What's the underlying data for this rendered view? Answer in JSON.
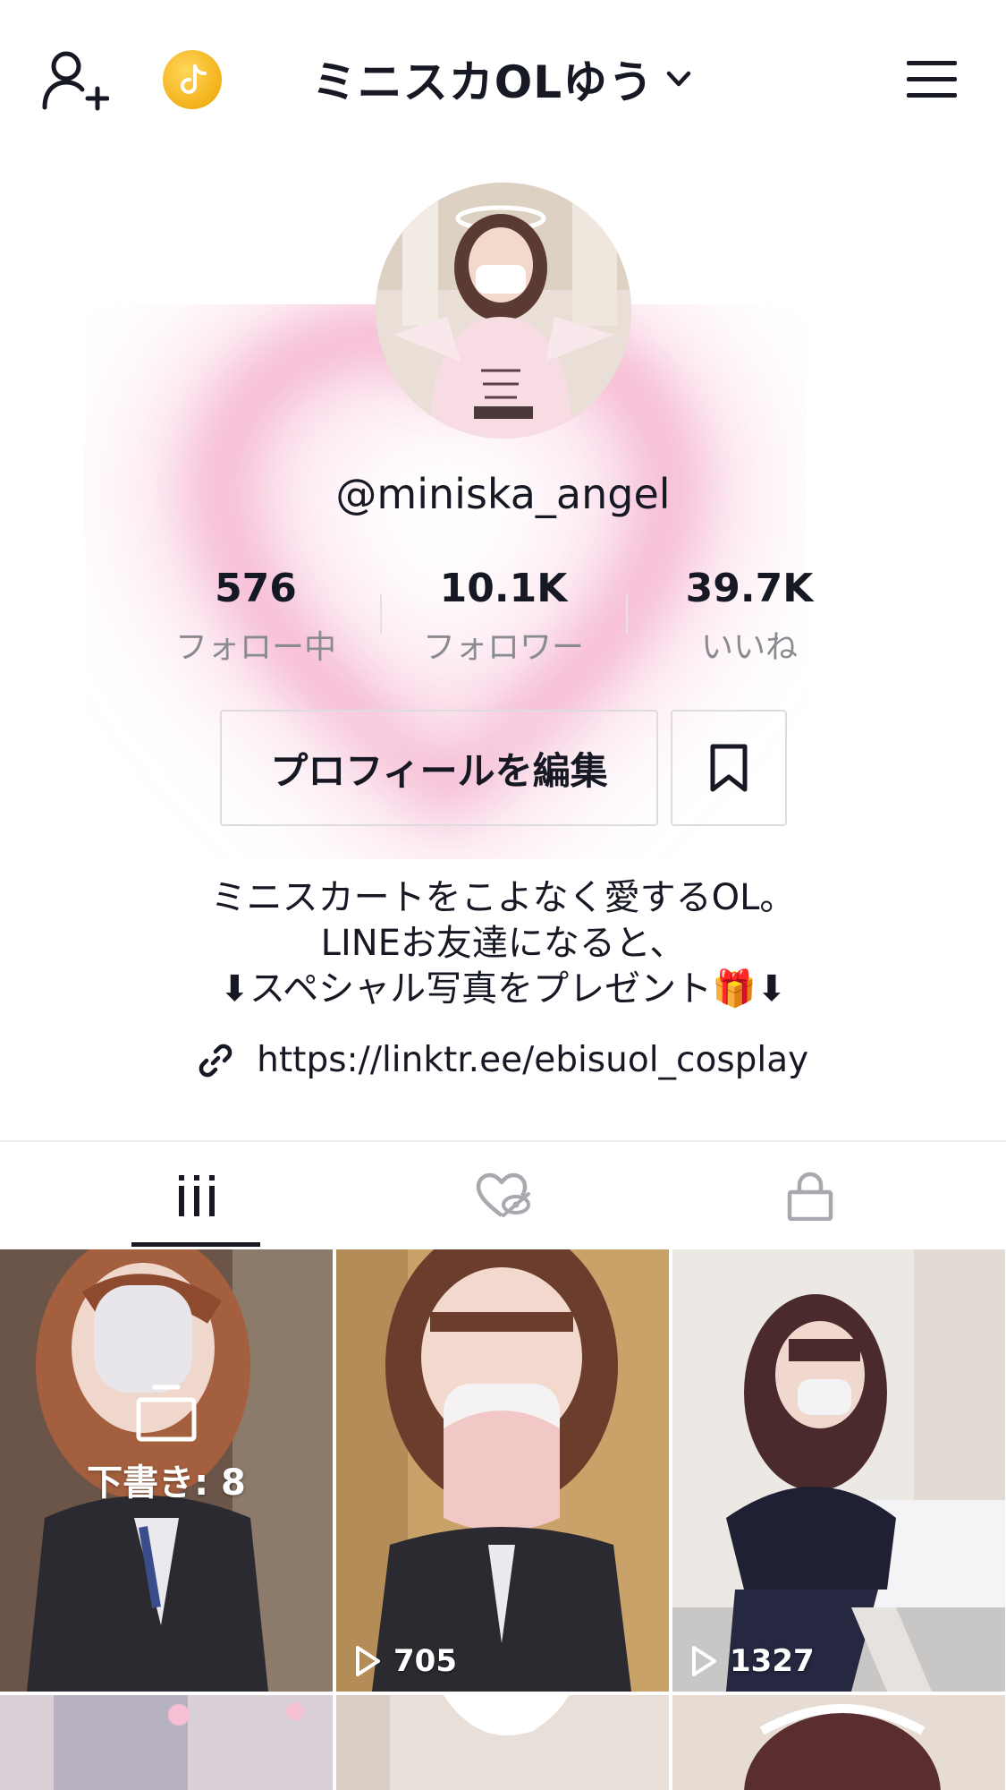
{
  "header": {
    "display_name": "ミニスカOLゆう",
    "icons": [
      "add-user-icon",
      "tiktok-coin-icon",
      "chevron-down-icon",
      "menu-icon"
    ]
  },
  "profile": {
    "username": "@miniska_angel"
  },
  "stats": [
    {
      "value": "576",
      "label": "フォロー中"
    },
    {
      "value": "10.1K",
      "label": "フォロワー"
    },
    {
      "value": "39.7K",
      "label": "いいね"
    }
  ],
  "buttons": {
    "edit_profile": "プロフィールを編集"
  },
  "bio": {
    "line1": "ミニスカートをこよなく愛するOL。",
    "line2": "LINEお友達になると、",
    "line3": "⬇スペシャル写真をプレゼント🎁⬇",
    "link": "https://linktr.ee/ebisuol_cosplay"
  },
  "tabs": [
    "videos-tab",
    "liked-tab",
    "private-tab"
  ],
  "grid": {
    "draft_label": "下書き: 8",
    "items": [
      {
        "views": "705"
      },
      {
        "views": "1327"
      }
    ]
  },
  "colors": {
    "text": "#161823",
    "muted": "#8a8b91",
    "heart_glow": "#f4a6c8",
    "coin": "#f3b21a"
  }
}
